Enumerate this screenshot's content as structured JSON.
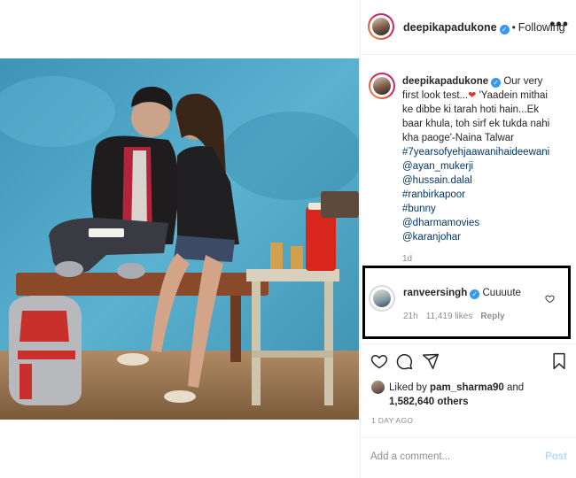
{
  "header": {
    "username": "deepikapadukone",
    "separator": "•",
    "follow_status": "Following",
    "more_icon": "ellipsis-icon"
  },
  "caption": {
    "username": "deepikapadukone",
    "text_1": "Our very first look test...",
    "text_2": "'Yaadein mithai ke dibbe ki tarah hoti hain...Ek baar khula, toh sirf ek tukda nahi kha paoge'-Naina Talwar",
    "tags": [
      "#7yearsofyehjaawanihaideewani",
      "@ayan_mukerji",
      "@hussain.dalal",
      "#ranbirkapoor",
      "#bunny",
      "@dharmamovies",
      "@karanjohar"
    ],
    "time": "1d"
  },
  "comment": {
    "username": "ranveersingh",
    "text": "Cuuuute",
    "time": "21h",
    "likes": "11,419 likes",
    "reply": "Reply"
  },
  "likes": {
    "prefix": "Liked by",
    "user": "pam_sharma90",
    "and": "and",
    "others": "1,582,640 others"
  },
  "timestamp": "1 DAY AGO",
  "comment_box": {
    "placeholder": "Add a comment...",
    "post_label": "Post"
  },
  "colors": {
    "verified_blue": "#3897f0",
    "link_blue": "#00376b",
    "muted_gray": "#8e8e8e",
    "post_disabled": "#b3dbff",
    "wall_blue": "#4aa3c4"
  }
}
